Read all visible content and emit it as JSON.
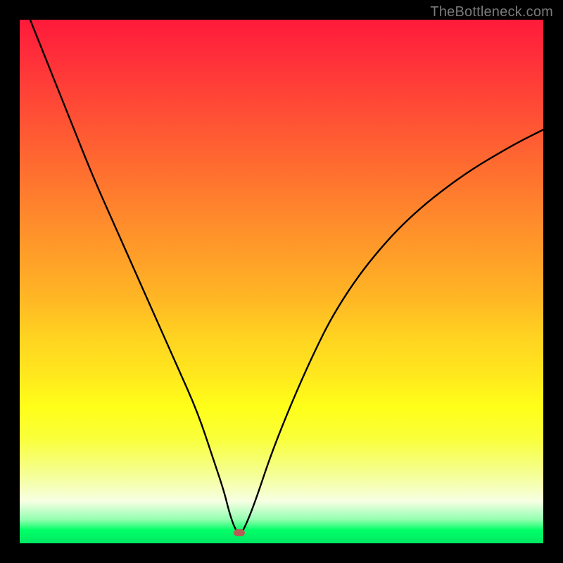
{
  "watermark": "TheBottleneck.com",
  "chart_data": {
    "type": "line",
    "title": "",
    "xlabel": "",
    "ylabel": "",
    "xlim": [
      0,
      100
    ],
    "ylim": [
      0,
      100
    ],
    "grid": false,
    "legend": false,
    "marker": {
      "x": 42,
      "y": 2
    },
    "series": [
      {
        "name": "bottleneck-curve",
        "x": [
          2,
          6,
          10,
          14,
          18,
          22,
          26,
          30,
          34,
          37,
          39,
          40,
          41,
          42,
          43,
          45,
          48,
          52,
          56,
          60,
          66,
          74,
          84,
          94,
          100
        ],
        "y": [
          100,
          90,
          80,
          70,
          61,
          52,
          43,
          34,
          25,
          16,
          10,
          6,
          3,
          1.5,
          3,
          8,
          17,
          27,
          36,
          44,
          53,
          62,
          70,
          76,
          79
        ]
      }
    ],
    "background_gradient": {
      "top_color": "#ff1a3a",
      "mid_color": "#ffe81d",
      "bottom_color": "#00e864"
    }
  }
}
